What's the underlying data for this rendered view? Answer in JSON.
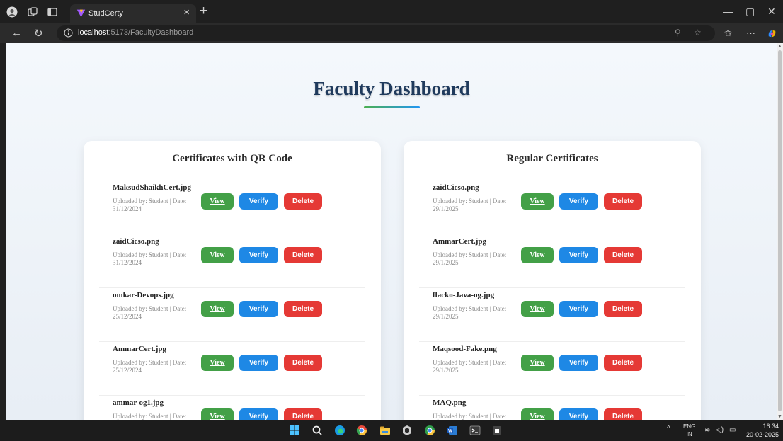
{
  "browser": {
    "tab_title": "StudCerty",
    "tab_close": "×",
    "new_tab": "+",
    "url_host": "localhost",
    "url_path": ":5173/FacultyDashboard",
    "minimize": "—",
    "maximize": "▢",
    "close": "✕",
    "more": "···"
  },
  "page": {
    "title": "Faculty Dashboard",
    "accent_colors": {
      "green": "#43a047",
      "blue": "#1e88e5",
      "red": "#e53935"
    }
  },
  "sections": [
    {
      "heading": "Certificates with QR Code",
      "items": [
        {
          "name": "MaksudShaikhCert.jpg",
          "meta": "Uploaded by: Student | Date: 31/12/2024"
        },
        {
          "name": "zaidCicso.png",
          "meta": "Uploaded by: Student | Date: 31/12/2024"
        },
        {
          "name": "omkar-Devops.jpg",
          "meta": "Uploaded by: Student | Date: 25/12/2024"
        },
        {
          "name": "AmmarCert.jpg",
          "meta": "Uploaded by: Student | Date: 25/12/2024"
        },
        {
          "name": "ammar-og1.jpg",
          "meta": "Uploaded by: Student | Date:"
        }
      ]
    },
    {
      "heading": "Regular Certificates",
      "items": [
        {
          "name": "zaidCicso.png",
          "meta": "Uploaded by: Student | Date: 29/1/2025"
        },
        {
          "name": "AmmarCert.jpg",
          "meta": "Uploaded by: Student | Date: 29/1/2025"
        },
        {
          "name": "flacko-Java-og.jpg",
          "meta": "Uploaded by: Student | Date: 29/1/2025"
        },
        {
          "name": "Maqsood-Fake.png",
          "meta": "Uploaded by: Student | Date: 29/1/2025"
        },
        {
          "name": "MAQ.png",
          "meta": "Uploaded by: Student | Date:"
        }
      ]
    }
  ],
  "buttons": {
    "view": "View",
    "verify": "Verify",
    "delete": "Delete"
  },
  "taskbar": {
    "lang_top": "ENG",
    "lang_bottom": "IN",
    "time": "16:34",
    "date": "20-02-2025",
    "tray_chevron": "^"
  }
}
